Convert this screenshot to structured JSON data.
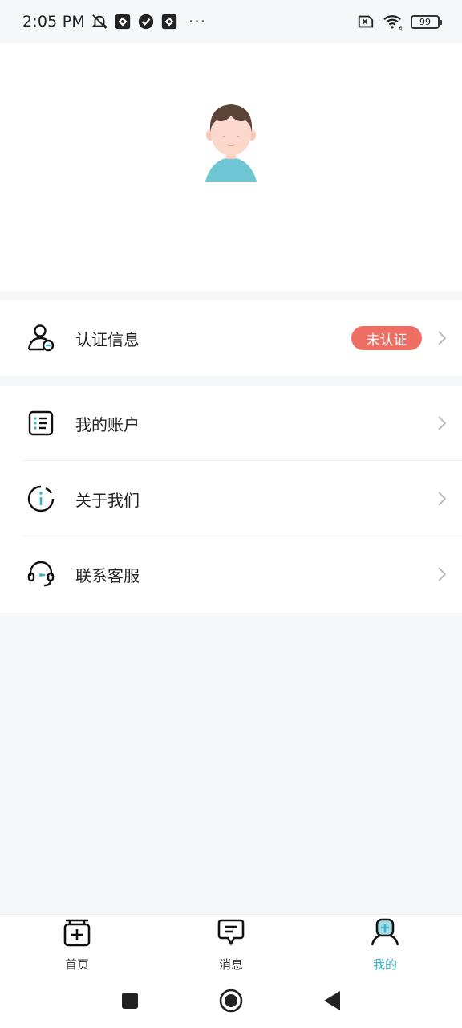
{
  "status_bar": {
    "time": "2:05 PM",
    "icons_left": [
      "mute-bell-icon",
      "app-notification-icon",
      "check-circle-icon",
      "app-notification-icon"
    ],
    "more": "···",
    "icons_right": [
      "sim-error-icon",
      "wifi-icon",
      "battery-icon"
    ],
    "battery": "99",
    "wifi_generation": "6"
  },
  "profile": {
    "avatar": "avatar-icon"
  },
  "auth": {
    "label": "认证信息",
    "icon": "user-verify-icon",
    "badge": "未认证",
    "badge_color": "#ef6e64"
  },
  "menu": {
    "items": [
      {
        "label": "我的账户",
        "icon": "account-list-icon"
      },
      {
        "label": "关于我们",
        "icon": "info-icon"
      },
      {
        "label": "联系客服",
        "icon": "headset-icon"
      }
    ]
  },
  "tab_bar": {
    "tabs": [
      {
        "label": "首页",
        "icon": "home-plus-icon",
        "active": false
      },
      {
        "label": "消息",
        "icon": "message-icon",
        "active": false
      },
      {
        "label": "我的",
        "icon": "profile-icon",
        "active": true
      }
    ],
    "active_color": "#3bb4c9"
  },
  "nav_bar": {
    "buttons": [
      "recent-apps-icon",
      "home-icon",
      "back-icon"
    ]
  }
}
